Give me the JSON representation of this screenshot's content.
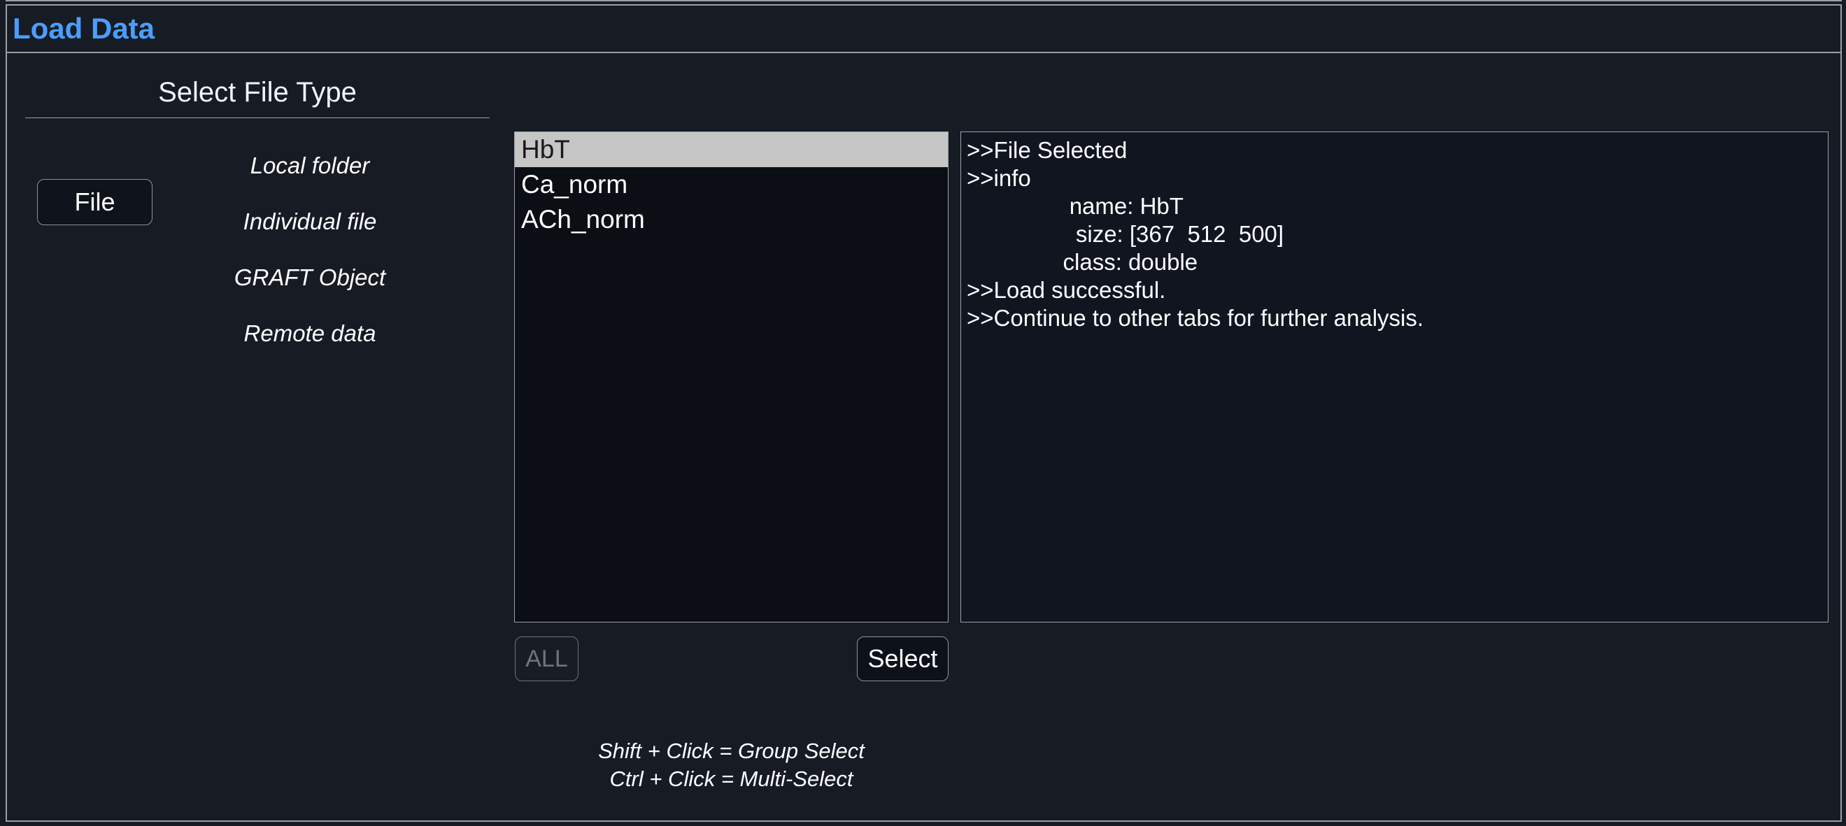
{
  "window": {
    "title": "Load Data"
  },
  "filetype_panel": {
    "header": "Select File Type",
    "button_label": "File",
    "options": [
      {
        "label": "Local folder"
      },
      {
        "label": "Individual file"
      },
      {
        "label": "GRAFT Object"
      },
      {
        "label": "Remote data"
      }
    ]
  },
  "variable_list": {
    "items": [
      {
        "label": "HbT",
        "selected": true
      },
      {
        "label": "Ca_norm",
        "selected": false
      },
      {
        "label": "ACh_norm",
        "selected": false
      }
    ]
  },
  "actions": {
    "all_label": "ALL",
    "all_enabled": false,
    "select_label": "Select"
  },
  "hints": {
    "line1": "Shift + Click = Group Select",
    "line2": "Ctrl + Click = Multi-Select"
  },
  "log": {
    "lines": [
      ">>File Selected",
      ">>info",
      "                name: HbT",
      "                 size: [367  512  500]",
      "               class: double",
      ">>Load successful.",
      ">>Continue to other tabs for further analysis."
    ]
  },
  "colors": {
    "background": "#171b24",
    "accent_title": "#4a9eff",
    "border": "#9aa0a6",
    "list_selected_bg": "#c6c6c6",
    "text": "#ffffff",
    "disabled_text": "#6f757d"
  }
}
